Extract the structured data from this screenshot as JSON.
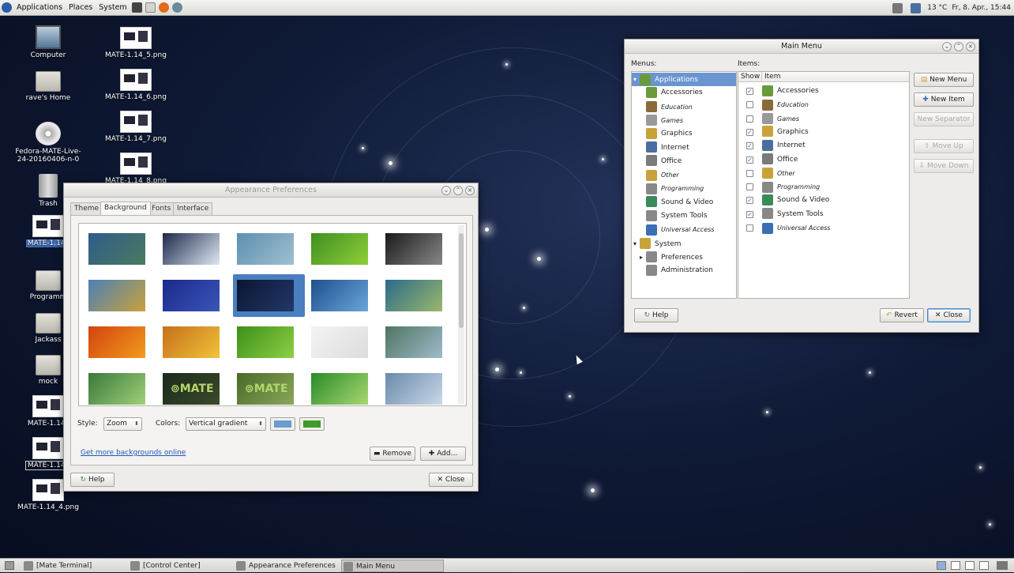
{
  "top_panel": {
    "menus": [
      "Applications",
      "Places",
      "System"
    ],
    "weather": "13 °C",
    "clock": "Fr,  8. Apr., 15:44"
  },
  "desktop_icons": [
    "Computer",
    "rave's Home",
    "Fedora-MATE-Live-24-20160406-n-0",
    "Trash",
    "MATE-1.14_",
    "Programm",
    "Jackass",
    "mock",
    "MATE-1.14_",
    "MATE-1.14_",
    "MATE-1.14_4.png",
    "MATE-1.14_5.png",
    "MATE-1.14_6.png",
    "MATE-1.14_7.png",
    "MATE-1.14_8.png"
  ],
  "appearance": {
    "title": "Appearance Preferences",
    "tabs": [
      "Theme",
      "Background",
      "Fonts",
      "Interface"
    ],
    "active_tab": "Background",
    "style_label": "Style:",
    "style_value": "Zoom",
    "colors_label": "Colors:",
    "colors_value": "Vertical gradient",
    "color1": "#6a9ccf",
    "color2": "#3f9a2a",
    "link": "Get more backgrounds online",
    "remove": "Remove",
    "add": "Add...",
    "help": "Help",
    "close": "Close",
    "backgrounds": [
      [
        "#2f5c8a",
        "#4a7a60"
      ],
      [
        "#1c2a4a",
        "#dfe8f4"
      ],
      [
        "#5d8fb0",
        "#9fc0cf"
      ],
      [
        "#3e8f1f",
        "#8fcf3a"
      ],
      [
        "#1a1a1a",
        "#888"
      ],
      [
        "#4c7fb8",
        "#c9a23a"
      ],
      [
        "#1b2a8a",
        "#3a55b8"
      ],
      [
        "#0b1530",
        "#22386a"
      ],
      [
        "#1d4f8f",
        "#6aa6d8"
      ],
      [
        "#2b6a8a",
        "#9ab86a"
      ],
      [
        "#d3430d",
        "#f29b1e"
      ],
      [
        "#c7701a",
        "#f0c23a"
      ],
      [
        "#3c8f1a",
        "#8ed044"
      ],
      [
        "#f4f4f4",
        "#dcdcdc"
      ],
      [
        "#4e7560",
        "#9fbacb"
      ],
      [
        "#3a7a3a",
        "#9fcf7a"
      ],
      [
        "#1c2a1c",
        "#3a4a2a"
      ],
      [
        "#4a6a2a",
        "#8aa65a"
      ],
      [
        "#2a8a2a",
        "#a8d870"
      ],
      [
        "#6a8aaa",
        "#c8d8e8"
      ]
    ],
    "mate_labels": [
      "MATE",
      "MATE"
    ]
  },
  "main_menu": {
    "title": "Main Menu",
    "menus_label": "Menus:",
    "items_label": "Items:",
    "col_show": "Show",
    "col_item": "Item",
    "tree": [
      {
        "label": "Applications",
        "level": 0,
        "expander": "▾",
        "selected": true
      },
      {
        "label": "Accessories",
        "level": 1
      },
      {
        "label": "Education",
        "level": 1,
        "italic": true
      },
      {
        "label": "Games",
        "level": 1,
        "italic": true
      },
      {
        "label": "Graphics",
        "level": 1
      },
      {
        "label": "Internet",
        "level": 1
      },
      {
        "label": "Office",
        "level": 1
      },
      {
        "label": "Other",
        "level": 1,
        "italic": true
      },
      {
        "label": "Programming",
        "level": 1,
        "italic": true
      },
      {
        "label": "Sound & Video",
        "level": 1
      },
      {
        "label": "System Tools",
        "level": 1
      },
      {
        "label": "Universal Access",
        "level": 1,
        "italic": true
      },
      {
        "label": "System",
        "level": 0,
        "expander": "▾"
      },
      {
        "label": "Preferences",
        "level": 1,
        "expander": "▸"
      },
      {
        "label": "Administration",
        "level": 1
      }
    ],
    "items": [
      {
        "label": "Accessories",
        "checked": true
      },
      {
        "label": "Education",
        "checked": false,
        "italic": true
      },
      {
        "label": "Games",
        "checked": false,
        "italic": true
      },
      {
        "label": "Graphics",
        "checked": true
      },
      {
        "label": "Internet",
        "checked": true
      },
      {
        "label": "Office",
        "checked": true
      },
      {
        "label": "Other",
        "checked": false,
        "italic": true
      },
      {
        "label": "Programming",
        "checked": false,
        "italic": true
      },
      {
        "label": "Sound & Video",
        "checked": true
      },
      {
        "label": "System Tools",
        "checked": true
      },
      {
        "label": "Universal Access",
        "checked": false,
        "italic": true
      }
    ],
    "buttons": {
      "new_menu": "New Menu",
      "new_item": "New Item",
      "new_separator": "New Separator",
      "move_up": "Move Up",
      "move_down": "Move Down",
      "help": "Help",
      "revert": "Revert",
      "close": "Close"
    }
  },
  "taskbar": [
    "[Mate Terminal]",
    "[Control Center]",
    "Appearance Preferences",
    "Main Menu"
  ]
}
